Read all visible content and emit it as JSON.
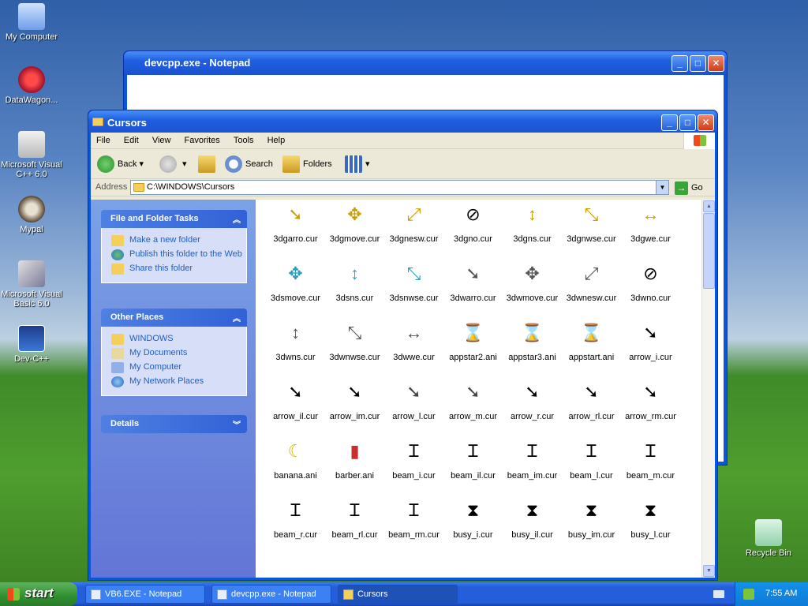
{
  "desktop": {
    "icons": [
      {
        "label": "My Computer"
      },
      {
        "label": "DataWagon..."
      },
      {
        "label": "Microsoft Visual C++ 6.0"
      },
      {
        "label": "Mypal"
      },
      {
        "label": "Microsoft Visual Basic 6.0"
      },
      {
        "label": "Dev-C++"
      },
      {
        "label": "Recycle Bin"
      }
    ]
  },
  "notepad": {
    "title": "devcpp.exe - Notepad"
  },
  "explorer": {
    "title": "Cursors",
    "menu": [
      "File",
      "Edit",
      "View",
      "Favorites",
      "Tools",
      "Help"
    ],
    "toolbar": {
      "back": "Back",
      "search": "Search",
      "folders": "Folders"
    },
    "address": {
      "label": "Address",
      "value": "C:\\WINDOWS\\Cursors",
      "go": "Go"
    },
    "tasks": {
      "title": "File and Folder Tasks",
      "items": [
        "Make a new folder",
        "Publish this folder to the Web",
        "Share this folder"
      ]
    },
    "other_places": {
      "title": "Other Places",
      "items": [
        "WINDOWS",
        "My Documents",
        "My Computer",
        "My Network Places"
      ]
    },
    "details": {
      "title": "Details"
    },
    "files": [
      "3dgarro.cur",
      "3dgmove.cur",
      "3dgnesw.cur",
      "3dgno.cur",
      "3dgns.cur",
      "3dgnwse.cur",
      "3dgwe.cur",
      "3dsmove.cur",
      "3dsns.cur",
      "3dsnwse.cur",
      "3dwarro.cur",
      "3dwmove.cur",
      "3dwnesw.cur",
      "3dwno.cur",
      "3dwns.cur",
      "3dwnwse.cur",
      "3dwwe.cur",
      "appstar2.ani",
      "appstar3.ani",
      "appstart.ani",
      "arrow_i.cur",
      "arrow_il.cur",
      "arrow_im.cur",
      "arrow_l.cur",
      "arrow_m.cur",
      "arrow_r.cur",
      "arrow_rl.cur",
      "arrow_rm.cur",
      "banana.ani",
      "barber.ani",
      "beam_i.cur",
      "beam_il.cur",
      "beam_im.cur",
      "beam_l.cur",
      "beam_m.cur",
      "beam_r.cur",
      "beam_rl.cur",
      "beam_rm.cur",
      "busy_i.cur",
      "busy_il.cur",
      "busy_im.cur",
      "busy_l.cur"
    ]
  },
  "taskbar": {
    "start": "start",
    "tasks": [
      "VB6.EXE - Notepad",
      "devcpp.exe - Notepad",
      "Cursors"
    ],
    "clock": "7:55 AM"
  }
}
